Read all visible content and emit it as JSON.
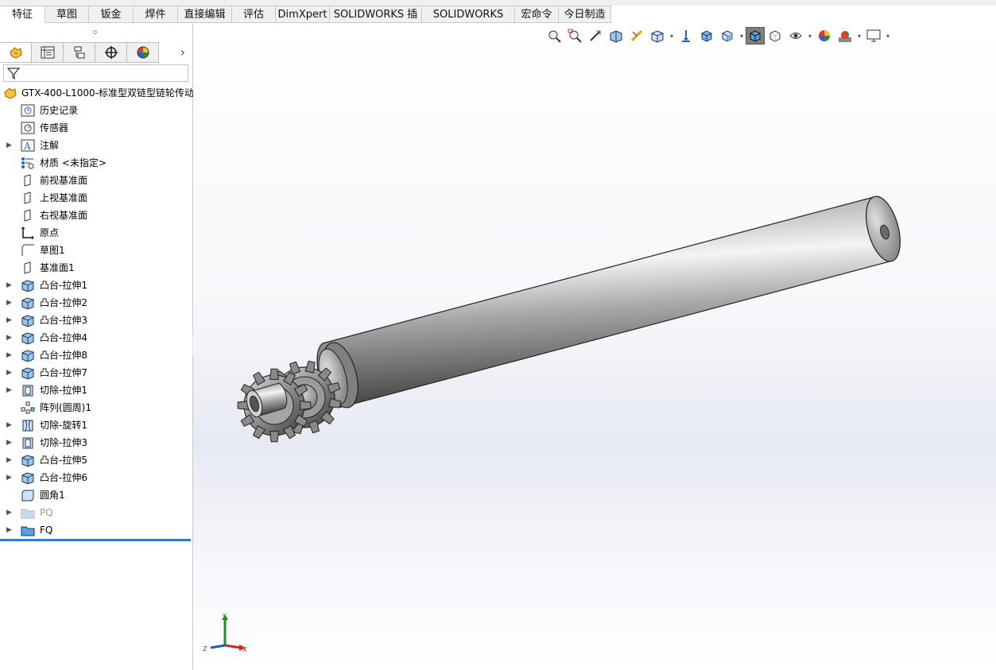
{
  "tabs": [
    {
      "label": "特征",
      "active": true
    },
    {
      "label": "草图"
    },
    {
      "label": "钣金"
    },
    {
      "label": "焊件"
    },
    {
      "label": "直接编辑"
    },
    {
      "label": "评估"
    },
    {
      "label": "DimXpert"
    },
    {
      "label": "SOLIDWORKS 插件"
    },
    {
      "label": "SOLIDWORKS MBD"
    },
    {
      "label": "宏命令"
    },
    {
      "label": "今日制造"
    }
  ],
  "manager_tabs": [
    "feature-manager",
    "property-manager",
    "configuration-manager",
    "dimxpert-manager",
    "display-manager"
  ],
  "tree": {
    "root": "GTX-400-L1000-标准型双链型链轮传动",
    "items": [
      {
        "label": "历史记录",
        "icon": "history-icon",
        "expandable": false
      },
      {
        "label": "传感器",
        "icon": "sensor-icon",
        "expandable": false
      },
      {
        "label": "注解",
        "icon": "annotation-icon",
        "expandable": true
      },
      {
        "label": "材质 <未指定>",
        "icon": "material-icon",
        "expandable": false
      },
      {
        "label": "前视基准面",
        "icon": "plane-icon",
        "expandable": false
      },
      {
        "label": "上视基准面",
        "icon": "plane-icon",
        "expandable": false
      },
      {
        "label": "右视基准面",
        "icon": "plane-icon",
        "expandable": false
      },
      {
        "label": "原点",
        "icon": "origin-icon",
        "expandable": false
      },
      {
        "label": "草图1",
        "icon": "sketch-icon",
        "expandable": false
      },
      {
        "label": "基准面1",
        "icon": "plane-icon",
        "expandable": false
      },
      {
        "label": "凸台-拉伸1",
        "icon": "boss-extrude-icon",
        "expandable": true
      },
      {
        "label": "凸台-拉伸2",
        "icon": "boss-extrude-icon",
        "expandable": true
      },
      {
        "label": "凸台-拉伸3",
        "icon": "boss-extrude-icon",
        "expandable": true
      },
      {
        "label": "凸台-拉伸4",
        "icon": "boss-extrude-icon",
        "expandable": true
      },
      {
        "label": "凸台-拉伸8",
        "icon": "boss-extrude-icon",
        "expandable": true
      },
      {
        "label": "凸台-拉伸7",
        "icon": "boss-extrude-icon",
        "expandable": true
      },
      {
        "label": "切除-拉伸1",
        "icon": "cut-extrude-icon",
        "expandable": true
      },
      {
        "label": "阵列(圆周)1",
        "icon": "circular-pattern-icon",
        "expandable": false
      },
      {
        "label": "切除-旋转1",
        "icon": "cut-revolve-icon",
        "expandable": true
      },
      {
        "label": "切除-拉伸3",
        "icon": "cut-extrude-icon",
        "expandable": true
      },
      {
        "label": "凸台-拉伸5",
        "icon": "boss-extrude-icon",
        "expandable": true
      },
      {
        "label": "凸台-拉伸6",
        "icon": "boss-extrude-icon",
        "expandable": true
      },
      {
        "label": "圆角1",
        "icon": "fillet-icon",
        "expandable": false
      },
      {
        "label": "PQ",
        "icon": "folder-icon",
        "expandable": true,
        "dim": true
      },
      {
        "label": "FQ",
        "icon": "folder-icon",
        "expandable": true
      }
    ]
  },
  "heads_up_toolbar": [
    "zoom-to-fit-icon",
    "zoom-to-area-icon",
    "previous-view-icon",
    "section-view-icon",
    "dynamic-annotation-icon",
    "view-orientation-icon",
    "dropdown",
    "view-normal-icon",
    "isometric-icon",
    "display-style-icon",
    "dropdown",
    "shaded-icon",
    "hidden-lines-icon",
    "hide-show-icon",
    "dropdown",
    "edit-appearance-icon",
    "apply-scene-icon",
    "dropdown",
    "view-settings-icon",
    "dropdown"
  ],
  "triad": {
    "x": "X",
    "y": "Y",
    "z": "Z"
  }
}
